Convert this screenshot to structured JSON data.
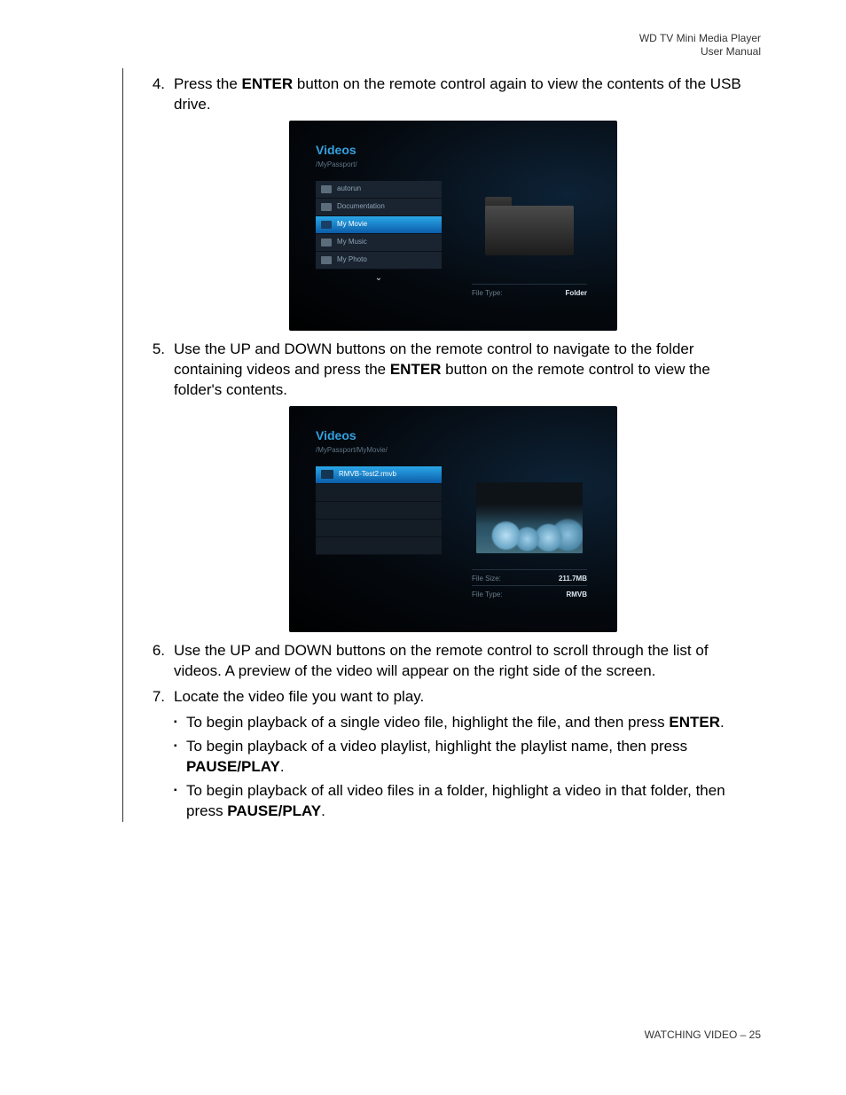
{
  "header": {
    "line1": "WD TV Mini Media Player",
    "line2": "User Manual"
  },
  "steps": {
    "s4": {
      "num": "4.",
      "pre": "Press the ",
      "bold": "ENTER",
      "post": " button on the remote control again to view the contents of the USB drive."
    },
    "s5": {
      "num": "5.",
      "pre": "Use the UP and DOWN buttons on the remote control to navigate to the folder containing videos and press the ",
      "bold": "ENTER",
      "post": " button on the remote control to view the folder's contents."
    },
    "s6": {
      "num": "6.",
      "text": "Use the UP and DOWN buttons on the remote control to scroll through the list of videos. A preview of the video will appear on the right side of the screen."
    },
    "s7": {
      "num": "7.",
      "text": "Locate the video file you want to play."
    },
    "b1": {
      "pre": "To begin playback of a single video file, highlight the file, and then press ",
      "bold": "ENTER",
      "post": "."
    },
    "b2": {
      "pre": "To begin playback of a video playlist, highlight the playlist name, then press ",
      "bold": "PAUSE/PLAY",
      "post": "."
    },
    "b3": {
      "pre": "To begin playback of all video files in a folder, highlight a video in that folder, then press ",
      "bold": "PAUSE/PLAY",
      "post": "."
    }
  },
  "screenshot1": {
    "title": "Videos",
    "path": "/MyPassport/",
    "items": [
      "autorun",
      "Documentation",
      "My Movie",
      "My Music",
      "My Photo"
    ],
    "selectedIndex": 2,
    "meta": {
      "filetype_label": "File Type:",
      "filetype_value": "Folder"
    }
  },
  "screenshot2": {
    "title": "Videos",
    "path": "/MyPassport/MyMovie/",
    "item": "RMVB-Test2.rmvb",
    "meta": {
      "filesize_label": "File Size:",
      "filesize_value": "211.7MB",
      "filetype_label": "File Type:",
      "filetype_value": "RMVB"
    }
  },
  "footer": {
    "text": "WATCHING VIDEO – 25"
  }
}
